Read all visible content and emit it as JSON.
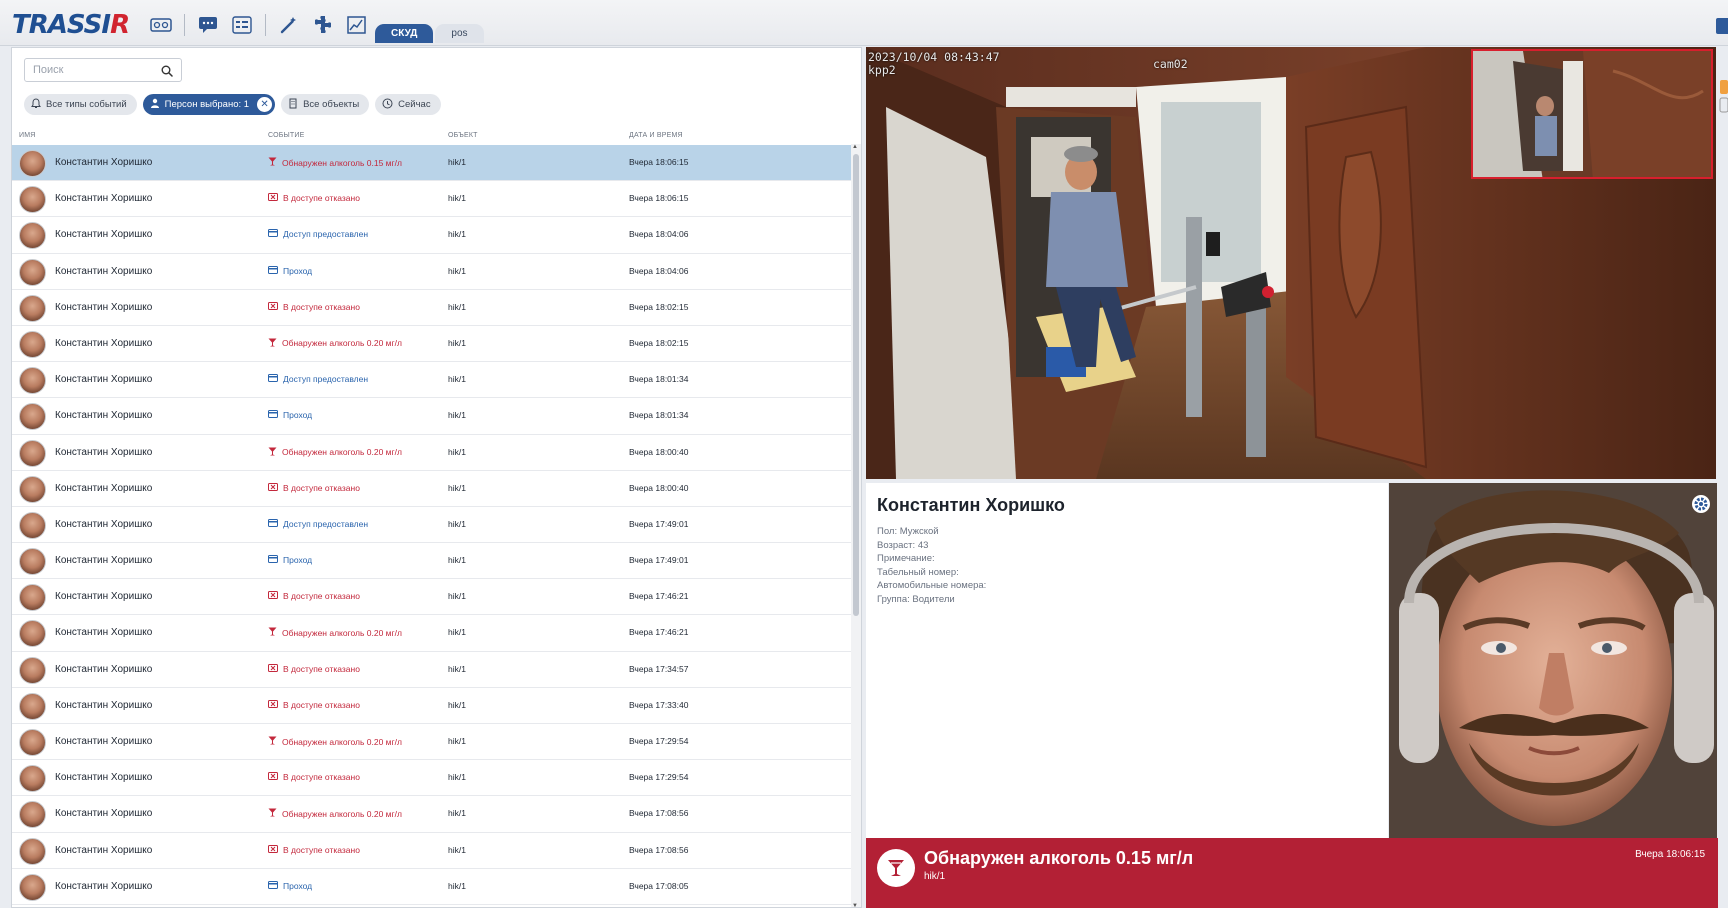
{
  "app": {
    "logo_text": "TRASSIR",
    "mode_tabs": [
      {
        "label": "СКУД",
        "active": true
      },
      {
        "label": "pos",
        "active": false
      }
    ]
  },
  "toolbar": {
    "icons": [
      "tape-icon",
      "chat-icon",
      "list-icon",
      "wand-icon",
      "puzzle-icon",
      "edit-chart-icon"
    ]
  },
  "search": {
    "placeholder": "Поиск",
    "value": ""
  },
  "filters": [
    {
      "label": "Все типы событий",
      "icon": "bell-icon",
      "active": false
    },
    {
      "label": "Персон выбрано: 1",
      "icon": "person-icon",
      "active": true,
      "closable": true
    },
    {
      "label": "Все объекты",
      "icon": "building-icon",
      "active": false
    },
    {
      "label": "Сейчас",
      "icon": "clock-icon",
      "active": false
    }
  ],
  "table": {
    "columns": [
      "ИМЯ",
      "СОБЫТИЕ",
      "ОБЪЕКТ",
      "ДАТА И ВРЕМЯ"
    ],
    "rows": [
      {
        "name": "Константин Хоришко",
        "event": "Обнаружен алкоголь 0.15 мг/л",
        "type": "alcohol",
        "object": "hik/1",
        "time": "Вчера 18:06:15",
        "selected": true
      },
      {
        "name": "Константин Хоришко",
        "event": "В доступе отказано",
        "type": "denied",
        "object": "hik/1",
        "time": "Вчера 18:06:15"
      },
      {
        "name": "Константин Хоришко",
        "event": "Доступ предоставлен",
        "type": "granted",
        "object": "hik/1",
        "time": "Вчера 18:04:06"
      },
      {
        "name": "Константин Хоришко",
        "event": "Проход",
        "type": "pass",
        "object": "hik/1",
        "time": "Вчера 18:04:06"
      },
      {
        "name": "Константин Хоришко",
        "event": "В доступе отказано",
        "type": "denied",
        "object": "hik/1",
        "time": "Вчера 18:02:15"
      },
      {
        "name": "Константин Хоришко",
        "event": "Обнаружен алкоголь 0.20 мг/л",
        "type": "alcohol",
        "object": "hik/1",
        "time": "Вчера 18:02:15"
      },
      {
        "name": "Константин Хоришко",
        "event": "Доступ предоставлен",
        "type": "granted",
        "object": "hik/1",
        "time": "Вчера 18:01:34"
      },
      {
        "name": "Константин Хоришко",
        "event": "Проход",
        "type": "pass",
        "object": "hik/1",
        "time": "Вчера 18:01:34"
      },
      {
        "name": "Константин Хоришко",
        "event": "Обнаружен алкоголь 0.20 мг/л",
        "type": "alcohol",
        "object": "hik/1",
        "time": "Вчера 18:00:40"
      },
      {
        "name": "Константин Хоришко",
        "event": "В доступе отказано",
        "type": "denied",
        "object": "hik/1",
        "time": "Вчера 18:00:40"
      },
      {
        "name": "Константин Хоришко",
        "event": "Доступ предоставлен",
        "type": "granted",
        "object": "hik/1",
        "time": "Вчера 17:49:01"
      },
      {
        "name": "Константин Хоришко",
        "event": "Проход",
        "type": "pass",
        "object": "hik/1",
        "time": "Вчера 17:49:01"
      },
      {
        "name": "Константин Хоришко",
        "event": "В доступе отказано",
        "type": "denied",
        "object": "hik/1",
        "time": "Вчера 17:46:21"
      },
      {
        "name": "Константин Хоришко",
        "event": "Обнаружен алкоголь 0.20 мг/л",
        "type": "alcohol",
        "object": "hik/1",
        "time": "Вчера 17:46:21"
      },
      {
        "name": "Константин Хоришко",
        "event": "В доступе отказано",
        "type": "denied",
        "object": "hik/1",
        "time": "Вчера 17:34:57"
      },
      {
        "name": "Константин Хоришко",
        "event": "В доступе отказано",
        "type": "denied",
        "object": "hik/1",
        "time": "Вчера 17:33:40"
      },
      {
        "name": "Константин Хоришко",
        "event": "Обнаружен алкоголь 0.20 мг/л",
        "type": "alcohol",
        "object": "hik/1",
        "time": "Вчера 17:29:54"
      },
      {
        "name": "Константин Хоришко",
        "event": "В доступе отказано",
        "type": "denied",
        "object": "hik/1",
        "time": "Вчера 17:29:54"
      },
      {
        "name": "Константин Хоришко",
        "event": "Обнаружен алкоголь 0.20 мг/л",
        "type": "alcohol",
        "object": "hik/1",
        "time": "Вчера 17:08:56"
      },
      {
        "name": "Константин Хоришко",
        "event": "В доступе отказано",
        "type": "denied",
        "object": "hik/1",
        "time": "Вчера 17:08:56"
      },
      {
        "name": "Константин Хоришко",
        "event": "Проход",
        "type": "pass",
        "object": "hik/1",
        "time": "Вчера 17:08:05"
      }
    ]
  },
  "camera": {
    "timestamp": "2023/10/04 08:43:47",
    "location": "kpp2",
    "name": "cam02"
  },
  "person": {
    "name": "Константин Хоришко",
    "attributes": [
      "Пол: Мужской",
      "Возраст: 43",
      "Примечание:",
      "Табельный номер:",
      "Автомобильные номера:",
      "Группа: Водители"
    ]
  },
  "alert": {
    "title": "Обнаружен алкоголь 0.15 мг/л",
    "object": "hik/1",
    "time": "Вчера 18:06:15"
  },
  "colors": {
    "accent": "#2e5a9a",
    "alert_red": "#b32035",
    "event_red": "#c3283c",
    "event_blue": "#2a64ad",
    "selected_row": "#b9d3e8"
  }
}
